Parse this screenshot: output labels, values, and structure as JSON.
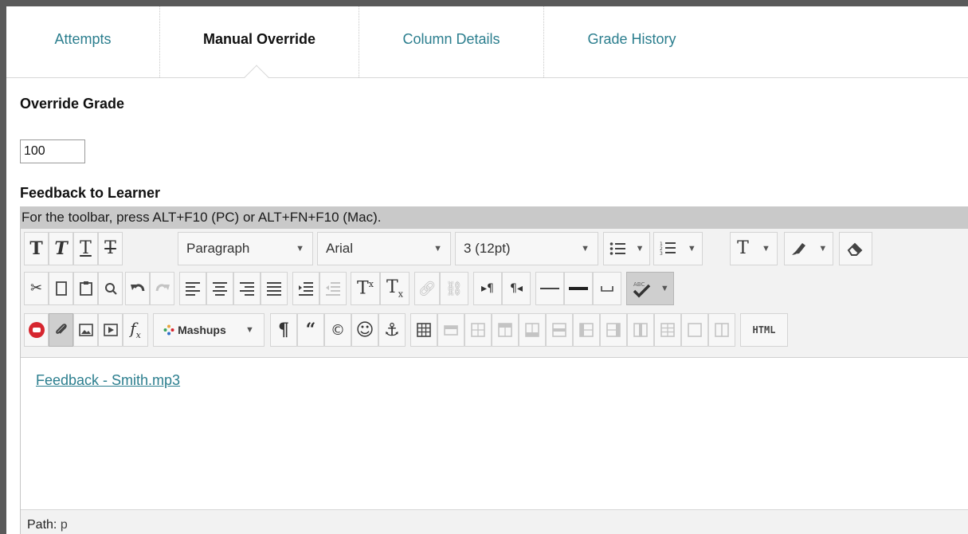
{
  "tabs": [
    {
      "label": "Attempts",
      "active": false
    },
    {
      "label": "Manual Override",
      "active": true
    },
    {
      "label": "Column Details",
      "active": false
    },
    {
      "label": "Grade History",
      "active": false
    }
  ],
  "override": {
    "label": "Override Grade",
    "value": "100"
  },
  "feedback": {
    "label": "Feedback to Learner",
    "hint": "For the toolbar, press ALT+F10 (PC) or ALT+FN+F10 (Mac)."
  },
  "toolbar": {
    "format_select": "Paragraph",
    "font_select": "Arial",
    "size_select": "3 (12pt)",
    "mashups_label": "Mashups",
    "html_label": "HTML",
    "row1_icons": [
      "bold-icon",
      "italic-icon",
      "underline-icon",
      "strikethrough-icon",
      "bullet-list-icon",
      "numbered-list-icon",
      "text-color-icon",
      "highlight-icon",
      "eraser-icon"
    ],
    "row2_icons": [
      "cut-icon",
      "copy-icon",
      "paste-icon",
      "find-icon",
      "undo-icon",
      "redo-icon",
      "align-left-icon",
      "align-center-icon",
      "align-right-icon",
      "justify-icon",
      "indent-icon",
      "outdent-icon",
      "superscript-icon",
      "subscript-icon",
      "link-icon",
      "unlink-icon",
      "ltr-icon",
      "rtl-icon",
      "horizontal-rule-icon",
      "line-icon",
      "nbsp-icon",
      "spellcheck-icon"
    ],
    "row3_icons": [
      "record-icon",
      "attach-icon",
      "image-icon",
      "media-icon",
      "math-icon",
      "mashups-icon",
      "paragraph-mark-icon",
      "quote-icon",
      "copyright-icon",
      "emoticon-icon",
      "anchor-icon",
      "table-icon"
    ]
  },
  "editor": {
    "link_text": "Feedback - Smith.mp3",
    "path_label": "Path:",
    "path_value": "p"
  },
  "colors": {
    "accent_link": "#2b7e8e",
    "frame": "#5a5a5a",
    "hint_bar": "#c9c9c9",
    "toolbar_bg": "#f2f2f2"
  }
}
